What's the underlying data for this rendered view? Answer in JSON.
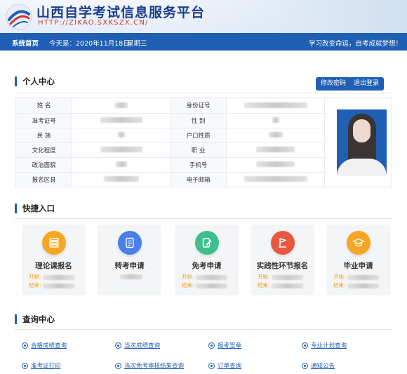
{
  "site": {
    "title": "山西自学考试信息服务平台",
    "url": "HTTP://ZIKAO.SXKSZX.CN/"
  },
  "nav": {
    "home": "系统首页",
    "today": "今天是：2020年11月18日",
    "weekday": "星期三",
    "slogan": "学习改变命运，自考成就梦想！"
  },
  "profile": {
    "title": "个人中心",
    "change_password": "修改密码",
    "logout": "退出登录",
    "rows": [
      {
        "l1": "姓    名",
        "l2": "身份证号"
      },
      {
        "l1": "准考证号",
        "l2": "性    别"
      },
      {
        "l1": "民    族",
        "l2": "户口性质"
      },
      {
        "l1": "文化程度",
        "l2": "职    业"
      },
      {
        "l1": "政治面貌",
        "l2": "手机号"
      },
      {
        "l1": "报名区县",
        "l2": "电子邮箱"
      }
    ]
  },
  "quick": {
    "title": "快捷入口",
    "start_label": "开始:",
    "end_label": "结束:",
    "cards": [
      {
        "label": "理论课报名",
        "color": "#f5a623"
      },
      {
        "label": "转考申请",
        "color": "#4a7ee8"
      },
      {
        "label": "免考申请",
        "color": "#3fbf8f"
      },
      {
        "label": "实践性环节报名",
        "color": "#e8573f"
      },
      {
        "label": "毕业申请",
        "color": "#f5a623"
      }
    ]
  },
  "query": {
    "title": "查询中心",
    "links": [
      "合格成绩查询",
      "当次成绩查询",
      "报考签章",
      "专业计划查询",
      "准考证打印",
      "当次免考审核结果查询",
      "订单查询",
      "通知公告"
    ]
  }
}
